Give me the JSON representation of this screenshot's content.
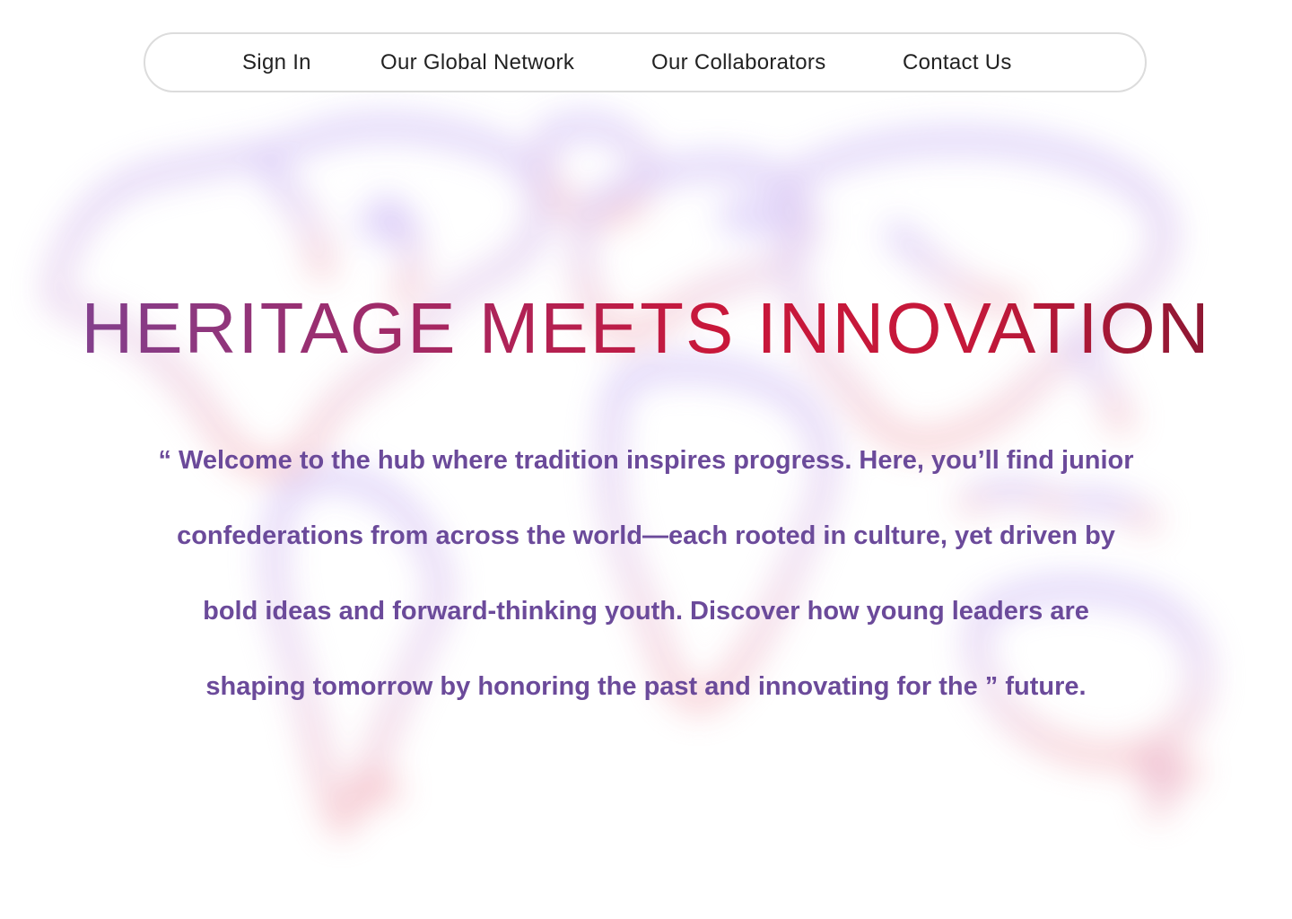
{
  "nav": {
    "items": [
      {
        "label": "Sign In"
      },
      {
        "label": "Our Global Network"
      },
      {
        "label": "Our Collaborators"
      },
      {
        "label": "Contact Us"
      }
    ]
  },
  "hero": {
    "title": "HERITAGE MEETS INNOVATION",
    "text": "“ Welcome to the hub where tradition inspires progress. Here, you’ll find junior confederations from across the world—each rooted in culture, yet driven by bold ideas and forward-thinking youth. Discover how young leaders are shaping tomorrow by honoring the past and innovating for the ” future."
  },
  "colors": {
    "title_gradient_start": "#7b4596",
    "title_gradient_mid": "#c8173a",
    "title_gradient_end": "#7a1730",
    "body_text": "#6b4a9a",
    "nav_text": "#222222",
    "nav_border": "#dcdcdc",
    "map_purple": "#c9b8f3",
    "map_pink": "#f2b4bd"
  }
}
